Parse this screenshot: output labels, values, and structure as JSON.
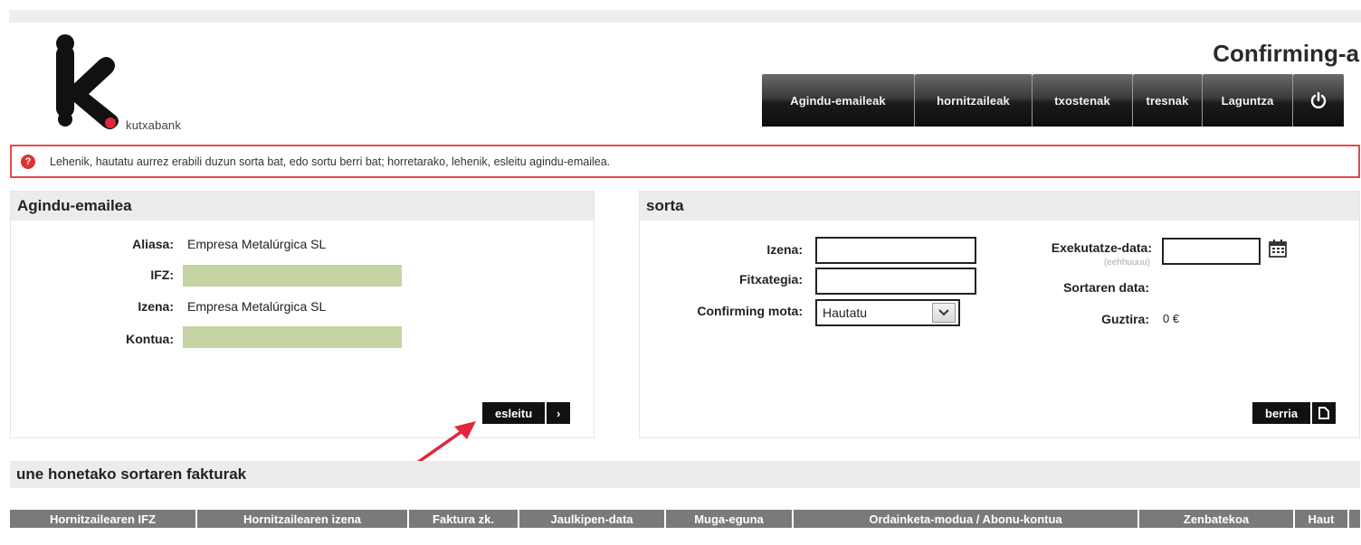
{
  "header": {
    "brand_name": "kutxabank",
    "app_title": "Confirming-a"
  },
  "nav": {
    "items": [
      {
        "label": "Agindu-emaileak"
      },
      {
        "label": "hornitzaileak"
      },
      {
        "label": "txostenak"
      },
      {
        "label": "tresnak"
      },
      {
        "label": "Laguntza"
      }
    ],
    "power_icon": "power-icon"
  },
  "alert": {
    "icon": "?",
    "text": "Lehenik, hautatu aurrez erabili duzun sorta bat, edo sortu berri bat; horretarako, lehenik, esleitu agindu-emailea."
  },
  "left_panel": {
    "title": "Agindu-emailea",
    "fields": [
      {
        "label": "Aliasa:",
        "value": "Empresa Metalúrgica SL"
      },
      {
        "label": "IFZ:",
        "value": ""
      },
      {
        "label": "Izena:",
        "value": "Empresa Metalúrgica SL"
      },
      {
        "label": "Kontua:",
        "value": ""
      }
    ],
    "button_label": "esleitu",
    "button_icon": "›"
  },
  "right_panel": {
    "title": "sorta",
    "izena_label": "Izena:",
    "fitxategia_label": "Fitxategia:",
    "mota_label": "Confirming mota:",
    "mota_value": "Hautatu",
    "exek_label": "Exekutatze-data:",
    "exek_hint": "(eehhuuuu)",
    "sortaren_label": "Sortaren data:",
    "guztira_label": "Guztira:",
    "guztira_value": "0 €",
    "button_label": "berria"
  },
  "invoices": {
    "title": "une honetako sortaren fakturak",
    "columns": [
      "Hornitzailearen IFZ",
      "Hornitzailearen izena",
      "Faktura zk.",
      "Jaulkipen-data",
      "Muga-eguna",
      "Ordainketa-modua / Abonu-kontua",
      "Zenbatekoa",
      "Haut"
    ]
  },
  "colors": {
    "alert_border": "#e04b4b",
    "masked_field": "#c6d3a5",
    "annotation_arrow": "#e0283a"
  }
}
